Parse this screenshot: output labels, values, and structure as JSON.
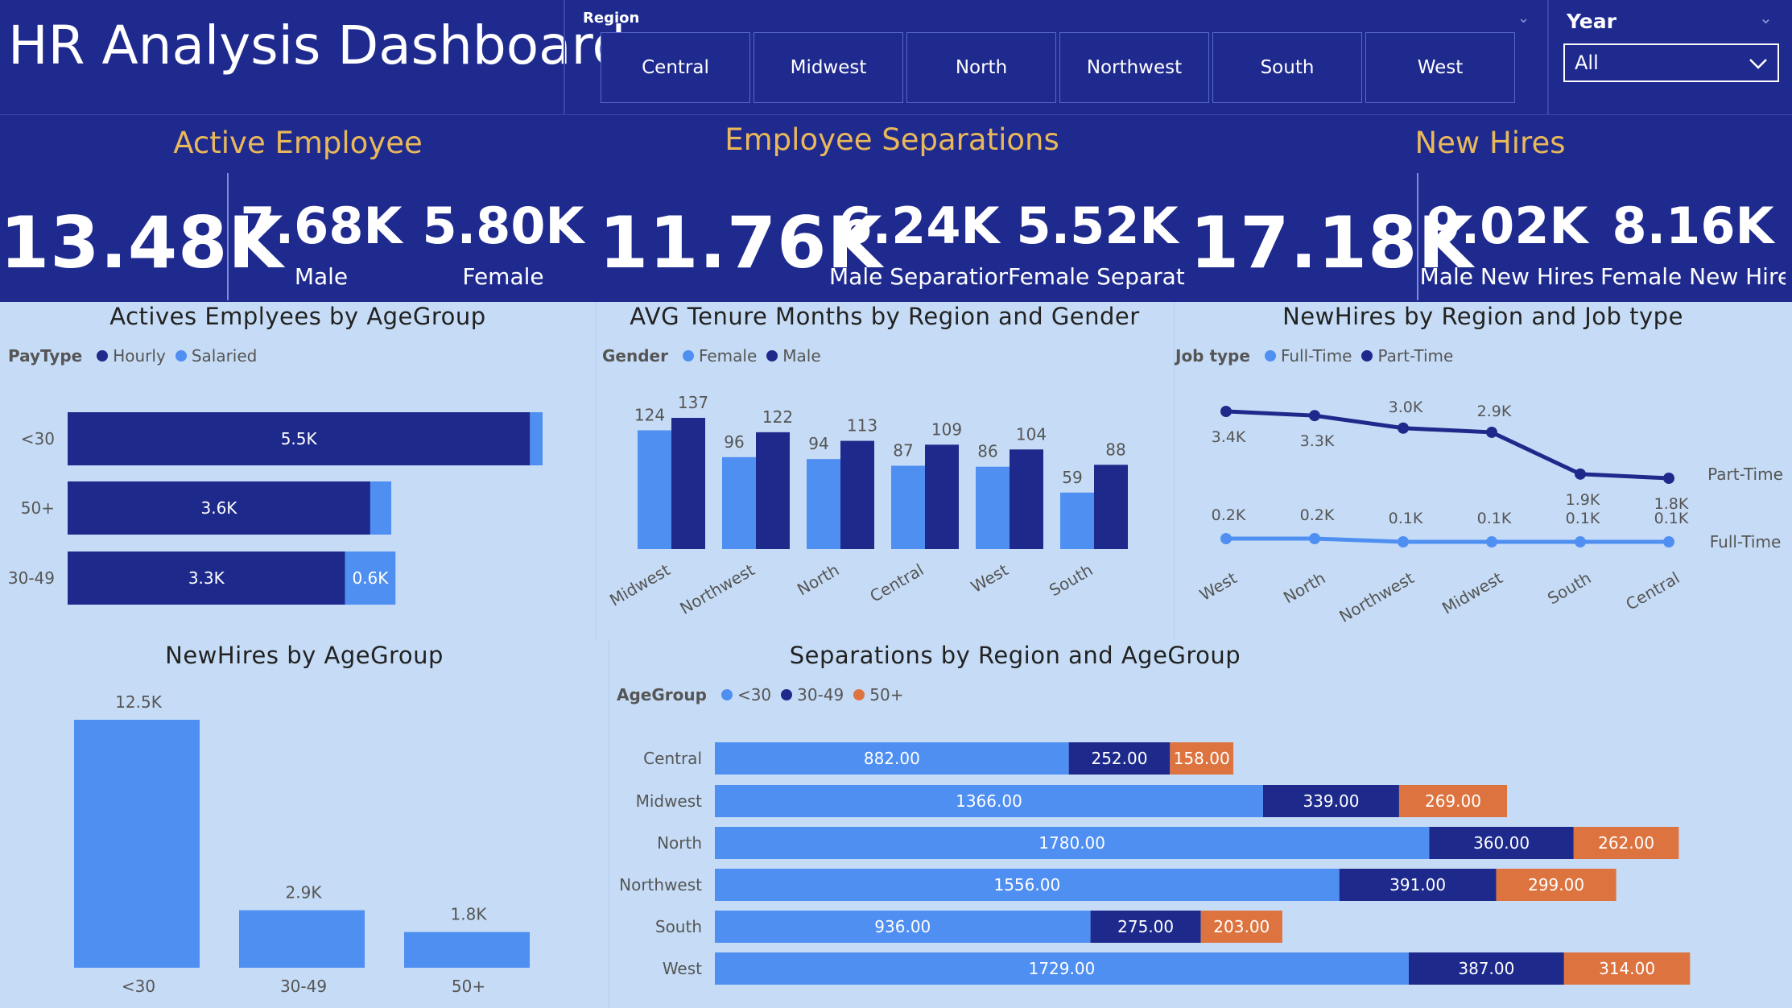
{
  "header": {
    "title": "HR Analysis Dashboard",
    "region_label": "Region",
    "regions": [
      "Central",
      "Midwest",
      "North",
      "Northwest",
      "South",
      "West"
    ],
    "year_label": "Year",
    "year_value": "All"
  },
  "kpis": {
    "active": {
      "heading": "Active Employee",
      "total": "13.48K",
      "male_value": "7.68K",
      "male_label": "Male",
      "female_value": "5.80K",
      "female_label": "Female"
    },
    "separations": {
      "heading": "Employee Separations",
      "total": "11.76K",
      "male_value": "6.24K",
      "male_label": "Male Separations",
      "female_value": "5.52K",
      "female_label": "Female Separati..."
    },
    "new_hires": {
      "heading": "New Hires",
      "total": "17.18K",
      "male_value": "9.02K",
      "male_label": "Male New Hires",
      "female_value": "8.16K",
      "female_label": "Female New Hires"
    }
  },
  "colors": {
    "navy": "#1f2a8f",
    "light_panel": "#c6dcf6",
    "gold": "#e9b85a",
    "series_dark": "#1d2a8c",
    "series_light": "#4f8ff2",
    "series_orange": "#dd7440"
  },
  "chart_data": [
    {
      "id": "actives_by_agegroup",
      "type": "bar",
      "orientation": "horizontal",
      "stacked": true,
      "title": "Actives Emplyees by AgeGroup",
      "legend_title": "PayType",
      "categories": [
        "<30",
        "50+",
        "30-49"
      ],
      "series": [
        {
          "name": "Hourly",
          "values": [
            5.5,
            3.6,
            3.3
          ],
          "labels": [
            "5.5K",
            "3.6K",
            "3.3K"
          ]
        },
        {
          "name": "Salaried",
          "values": [
            0.15,
            0.25,
            0.6
          ],
          "labels": [
            "",
            "",
            "0.6K"
          ]
        }
      ]
    },
    {
      "id": "tenure_by_region_gender",
      "type": "bar",
      "title": "AVG Tenure Months by Region and Gender",
      "legend_title": "Gender",
      "categories": [
        "Midwest",
        "Northwest",
        "North",
        "Central",
        "West",
        "South"
      ],
      "series": [
        {
          "name": "Female",
          "values": [
            124,
            96,
            94,
            87,
            86,
            59
          ]
        },
        {
          "name": "Male",
          "values": [
            137,
            122,
            113,
            109,
            104,
            88
          ]
        }
      ]
    },
    {
      "id": "newhires_by_region_jobtype",
      "type": "line",
      "title": "NewHires by Region and Job type",
      "legend_title": "Job type",
      "categories": [
        "West",
        "North",
        "Northwest",
        "Midwest",
        "South",
        "Central"
      ],
      "series": [
        {
          "name": "Full-Time",
          "values": [
            0.2,
            0.2,
            0.1,
            0.1,
            0.1,
            0.1
          ],
          "labels": [
            "0.2K",
            "0.2K",
            "0.1K",
            "0.1K",
            "0.1K",
            "0.1K"
          ],
          "end_label": "Full-Time"
        },
        {
          "name": "Part-Time",
          "values": [
            3.4,
            3.3,
            3.0,
            2.9,
            1.9,
            1.8
          ],
          "labels": [
            "3.4K",
            "3.3K",
            "3.0K",
            "2.9K",
            "1.9K",
            "1.8K"
          ],
          "end_label": "Part-Time"
        }
      ]
    },
    {
      "id": "newhires_by_agegroup",
      "type": "bar",
      "title": "NewHires by AgeGroup",
      "categories": [
        "<30",
        "30-49",
        "50+"
      ],
      "values": [
        12.5,
        2.9,
        1.8
      ],
      "labels": [
        "12.5K",
        "2.9K",
        "1.8K"
      ]
    },
    {
      "id": "separations_by_region_agegroup",
      "type": "bar",
      "orientation": "horizontal",
      "stacked": true,
      "title": "Separations by Region and AgeGroup",
      "legend_title": "AgeGroup",
      "categories": [
        "Central",
        "Midwest",
        "North",
        "Northwest",
        "South",
        "West"
      ],
      "series": [
        {
          "name": "<30",
          "values": [
            882,
            1366,
            1780,
            1556,
            936,
            1729
          ],
          "labels": [
            "882.00",
            "1366.00",
            "1780.00",
            "1556.00",
            "936.00",
            "1729.00"
          ]
        },
        {
          "name": "30-49",
          "values": [
            252,
            339,
            360,
            391,
            275,
            387
          ],
          "labels": [
            "252.00",
            "339.00",
            "360.00",
            "391.00",
            "275.00",
            "387.00"
          ]
        },
        {
          "name": "50+",
          "values": [
            158,
            269,
            262,
            299,
            203,
            314
          ],
          "labels": [
            "158.00",
            "269.00",
            "262.00",
            "299.00",
            "203.00",
            "314.00"
          ]
        }
      ]
    }
  ]
}
